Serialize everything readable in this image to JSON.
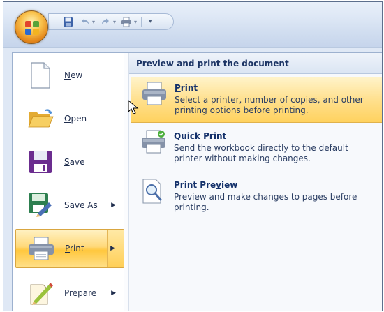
{
  "quick_access": {
    "buttons": [
      "save-icon",
      "undo-icon",
      "redo-icon",
      "print-icon"
    ],
    "customize_label": "▾"
  },
  "menu": {
    "items": [
      {
        "label": "New",
        "access_key": "N",
        "icon": "new-document-icon",
        "has_submenu": false
      },
      {
        "label": "Open",
        "access_key": "O",
        "icon": "open-folder-icon",
        "has_submenu": false
      },
      {
        "label": "Save",
        "access_key": "S",
        "icon": "save-disk-icon",
        "has_submenu": false
      },
      {
        "label": "Save As",
        "access_key": "A",
        "icon": "save-as-icon",
        "has_submenu": true
      },
      {
        "label": "Print",
        "access_key": "P",
        "icon": "printer-icon",
        "has_submenu": true,
        "active": true
      },
      {
        "label": "Prepare",
        "access_key": "e",
        "icon": "prepare-icon",
        "has_submenu": true
      }
    ],
    "submenu_arrow": "▶"
  },
  "print_panel": {
    "header": "Preview and print the document",
    "options": [
      {
        "title": "Print",
        "access_key": "P",
        "description": "Select a printer, number of copies, and other printing options before printing.",
        "icon": "printer-icon",
        "highlighted": true
      },
      {
        "title": "Quick Print",
        "access_key": "Q",
        "description": "Send the workbook directly to the default printer without making changes.",
        "icon": "quick-print-icon",
        "highlighted": false
      },
      {
        "title": "Print Preview",
        "access_key": "v",
        "description": "Preview and make changes to pages before printing.",
        "icon": "print-preview-icon",
        "highlighted": false
      }
    ]
  },
  "colors": {
    "highlight": "#ffd97a",
    "header_text": "#1b3464",
    "frame": "#dfe8f5"
  }
}
